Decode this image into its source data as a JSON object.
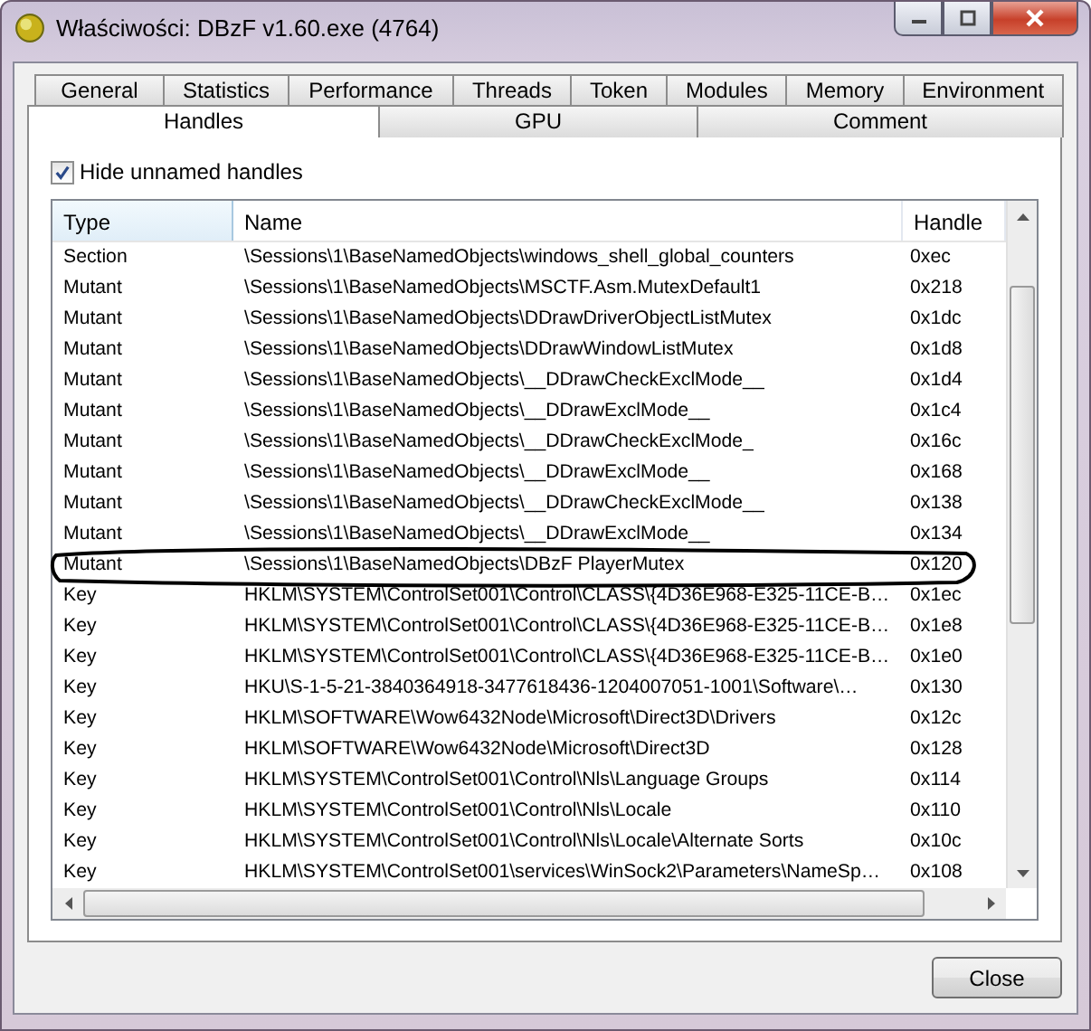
{
  "window": {
    "title": "Właściwości: DBzF v1.60.exe (4764)"
  },
  "tabs": [
    [
      {
        "label": "General",
        "selected": false
      },
      {
        "label": "Statistics",
        "selected": false
      },
      {
        "label": "Performance",
        "selected": false
      },
      {
        "label": "Threads",
        "selected": false
      },
      {
        "label": "Token",
        "selected": false
      },
      {
        "label": "Modules",
        "selected": false
      },
      {
        "label": "Memory",
        "selected": false
      },
      {
        "label": "Environment",
        "selected": false
      }
    ],
    [
      {
        "label": "Handles",
        "selected": true
      },
      {
        "label": "GPU",
        "selected": false
      },
      {
        "label": "Comment",
        "selected": false
      }
    ]
  ],
  "hide_unnamed": {
    "label": "Hide unnamed handles",
    "checked": true
  },
  "table": {
    "columns": [
      "Type",
      "Name",
      "Handle"
    ],
    "rows": [
      {
        "type": "Section",
        "name": "\\Sessions\\1\\BaseNamedObjects\\windows_shell_global_counters",
        "handle": "0xec",
        "circled": false
      },
      {
        "type": "Mutant",
        "name": "\\Sessions\\1\\BaseNamedObjects\\MSCTF.Asm.MutexDefault1",
        "handle": "0x218",
        "circled": false
      },
      {
        "type": "Mutant",
        "name": "\\Sessions\\1\\BaseNamedObjects\\DDrawDriverObjectListMutex",
        "handle": "0x1dc",
        "circled": false
      },
      {
        "type": "Mutant",
        "name": "\\Sessions\\1\\BaseNamedObjects\\DDrawWindowListMutex",
        "handle": "0x1d8",
        "circled": false
      },
      {
        "type": "Mutant",
        "name": "\\Sessions\\1\\BaseNamedObjects\\__DDrawCheckExclMode__",
        "handle": "0x1d4",
        "circled": false
      },
      {
        "type": "Mutant",
        "name": "\\Sessions\\1\\BaseNamedObjects\\__DDrawExclMode__",
        "handle": "0x1c4",
        "circled": false
      },
      {
        "type": "Mutant",
        "name": "\\Sessions\\1\\BaseNamedObjects\\__DDrawCheckExclMode_",
        "handle": "0x16c",
        "circled": false
      },
      {
        "type": "Mutant",
        "name": "\\Sessions\\1\\BaseNamedObjects\\__DDrawExclMode__",
        "handle": "0x168",
        "circled": false
      },
      {
        "type": "Mutant",
        "name": "\\Sessions\\1\\BaseNamedObjects\\__DDrawCheckExclMode__",
        "handle": "0x138",
        "circled": false
      },
      {
        "type": "Mutant",
        "name": "\\Sessions\\1\\BaseNamedObjects\\__DDrawExclMode__",
        "handle": "0x134",
        "circled": false
      },
      {
        "type": "Mutant",
        "name": "\\Sessions\\1\\BaseNamedObjects\\DBzF PlayerMutex",
        "handle": "0x120",
        "circled": true
      },
      {
        "type": "Key",
        "name": "HKLM\\SYSTEM\\ControlSet001\\Control\\CLASS\\{4D36E968-E325-11CE-B…",
        "handle": "0x1ec",
        "circled": false
      },
      {
        "type": "Key",
        "name": "HKLM\\SYSTEM\\ControlSet001\\Control\\CLASS\\{4D36E968-E325-11CE-B…",
        "handle": "0x1e8",
        "circled": false
      },
      {
        "type": "Key",
        "name": "HKLM\\SYSTEM\\ControlSet001\\Control\\CLASS\\{4D36E968-E325-11CE-B…",
        "handle": "0x1e0",
        "circled": false
      },
      {
        "type": "Key",
        "name": "HKU\\S-1-5-21-3840364918-3477618436-1204007051-1001\\Software\\…",
        "handle": "0x130",
        "circled": false
      },
      {
        "type": "Key",
        "name": "HKLM\\SOFTWARE\\Wow6432Node\\Microsoft\\Direct3D\\Drivers",
        "handle": "0x12c",
        "circled": false
      },
      {
        "type": "Key",
        "name": "HKLM\\SOFTWARE\\Wow6432Node\\Microsoft\\Direct3D",
        "handle": "0x128",
        "circled": false
      },
      {
        "type": "Key",
        "name": "HKLM\\SYSTEM\\ControlSet001\\Control\\Nls\\Language Groups",
        "handle": "0x114",
        "circled": false
      },
      {
        "type": "Key",
        "name": "HKLM\\SYSTEM\\ControlSet001\\Control\\Nls\\Locale",
        "handle": "0x110",
        "circled": false
      },
      {
        "type": "Key",
        "name": "HKLM\\SYSTEM\\ControlSet001\\Control\\Nls\\Locale\\Alternate Sorts",
        "handle": "0x10c",
        "circled": false
      },
      {
        "type": "Key",
        "name": "HKLM\\SYSTEM\\ControlSet001\\services\\WinSock2\\Parameters\\NameSp…",
        "handle": "0x108",
        "circled": false
      }
    ]
  },
  "buttons": [
    "Close"
  ]
}
